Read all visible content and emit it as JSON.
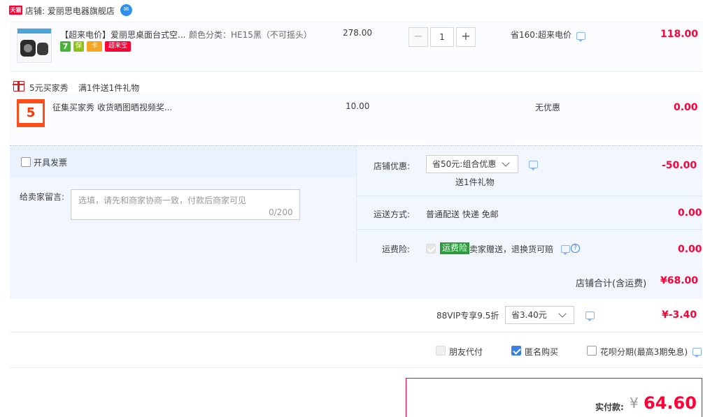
{
  "store": {
    "badge": "天猫",
    "label": "店铺: 爱丽思电器旗舰店",
    "wangwang_icon": "wangwang-chat-icon"
  },
  "item": {
    "title": "【超来电价】爱丽思桌面台式空...",
    "spec": "颜色分类：HE15黑（不可摇头）",
    "badges": [
      "7",
      "保",
      "卡",
      "超来宝"
    ],
    "unit_price": "278.00",
    "quantity": "1",
    "minus": "−",
    "plus": "+",
    "discount": "省160:超来电价",
    "total": "118.00"
  },
  "gift": {
    "label": "5元买家秀",
    "condition": "满1件送1件礼物",
    "thumb_text": "5",
    "title": "征集买家秀 收货晒图晒视频奖...",
    "price": "10.00",
    "discount": "无优惠",
    "total": "0.00"
  },
  "options": {
    "invoice_label": "开具发票",
    "message_label": "给卖家留言:",
    "message_placeholder": "选填，请先和商家协商一致，付款后商家可见",
    "message_count": "0/200",
    "store_discount_label": "店铺优惠:",
    "store_discount_value": "省50元:组合优惠",
    "store_discount_note": "送1件礼物",
    "store_discount_amount": "-50.00",
    "shipping_label": "运送方式:",
    "shipping_value": "普通配送 快递 免邮",
    "shipping_amount": "0.00",
    "insurance_label": "运费险:",
    "insurance_tag": "运费险",
    "insurance_text": "卖家赠送，退换货可赔",
    "insurance_amount": "0.00",
    "help": "?"
  },
  "store_total": {
    "label": "店铺合计(含运费)",
    "value": "¥68.00"
  },
  "vip": {
    "label": "88VIP专享9.5折",
    "select_value": "省3.40元",
    "amount": "¥-3.40"
  },
  "purchase_options": {
    "friend_pay": "朋友代付",
    "anonymous": "匿名购买",
    "installment": "花呗分期(最高3期免息)"
  },
  "pay": {
    "label": "实付款:",
    "currency": "¥",
    "amount": "64.60"
  },
  "colors": {
    "accent_red": "#ff0036",
    "light_blue_bg": "#f2f7ff",
    "checkbox_blue": "#3a7fe6"
  }
}
